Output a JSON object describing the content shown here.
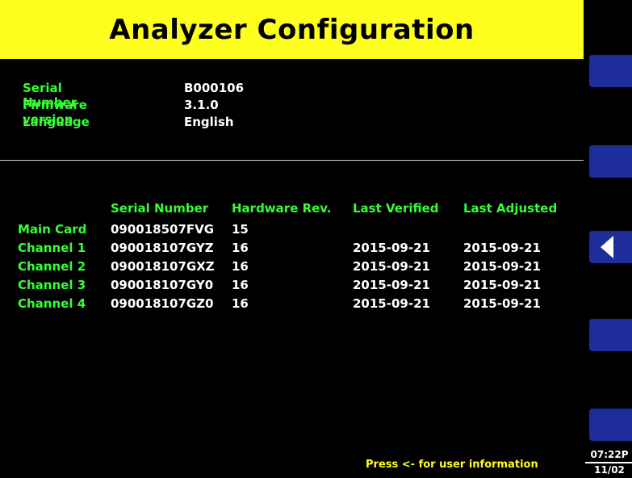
{
  "header": {
    "title": "Analyzer Configuration"
  },
  "info": [
    {
      "label": "Serial Number",
      "value": "B000106"
    },
    {
      "label": "Firmware version",
      "value": "3.1.0"
    },
    {
      "label": "Language",
      "value": "English"
    }
  ],
  "table": {
    "columns": [
      "",
      "Serial Number",
      "Hardware Rev.",
      "Last Verified",
      "Last Adjusted"
    ],
    "rows": [
      {
        "label": "Main Card",
        "serial": "090018507FVG",
        "hw": "15",
        "verified": "",
        "adjusted": ""
      },
      {
        "label": "Channel 1",
        "serial": "090018107GYZ",
        "hw": "16",
        "verified": "2015-09-21",
        "adjusted": "2015-09-21"
      },
      {
        "label": "Channel 2",
        "serial": "090018107GXZ",
        "hw": "16",
        "verified": "2015-09-21",
        "adjusted": "2015-09-21"
      },
      {
        "label": "Channel 3",
        "serial": "090018107GY0",
        "hw": "16",
        "verified": "2015-09-21",
        "adjusted": "2015-09-21"
      },
      {
        "label": "Channel 4",
        "serial": "090018107GZ0",
        "hw": "16",
        "verified": "2015-09-21",
        "adjusted": "2015-09-21"
      }
    ]
  },
  "footer": {
    "hint": "Press <-  for user information"
  },
  "sidebar": {
    "softkeys": [
      {
        "name": "softkey-1",
        "icon": ""
      },
      {
        "name": "softkey-2",
        "icon": ""
      },
      {
        "name": "softkey-3",
        "icon": "back-arrow-icon"
      },
      {
        "name": "softkey-4",
        "icon": ""
      },
      {
        "name": "softkey-5",
        "icon": ""
      }
    ]
  },
  "clock": {
    "time": "07:22P",
    "date": "11/02"
  },
  "colors": {
    "title_bg": "#ffff1f",
    "label_green": "#33ff33",
    "softkey_blue": "#1e2d9c"
  }
}
